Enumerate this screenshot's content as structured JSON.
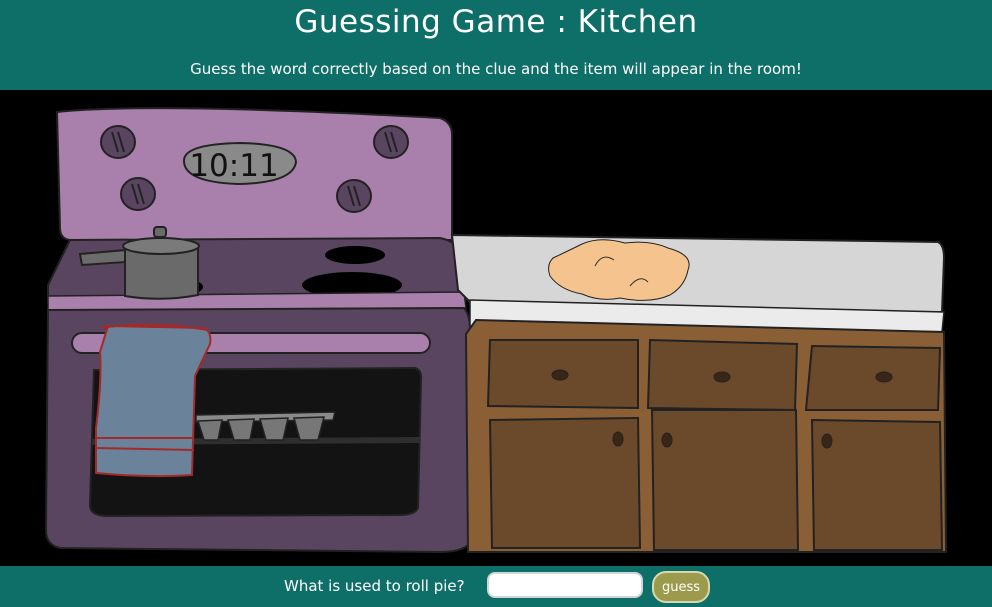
{
  "header": {
    "title": "Guessing Game : Kitchen",
    "subtitle": "Guess the word correctly based on the clue and the item will appear in the room!"
  },
  "scene": {
    "clock_time": "10:11",
    "items": [
      "stove",
      "oven",
      "pot",
      "towel",
      "muffin-tray",
      "counter",
      "dough",
      "cabinets"
    ]
  },
  "footer": {
    "question": "What is used to roll pie?",
    "input_value": "",
    "input_placeholder": "",
    "guess_label": "guess"
  },
  "colors": {
    "header_bg": "#0e6e68",
    "stove_backsplash": "#a97fab",
    "stove_body": "#5a4560",
    "cabinet_wood": "#6b4a2c",
    "countertop": "#d6d6d6",
    "dough": "#f5c38e",
    "guess_button": "#9c9a4d"
  }
}
